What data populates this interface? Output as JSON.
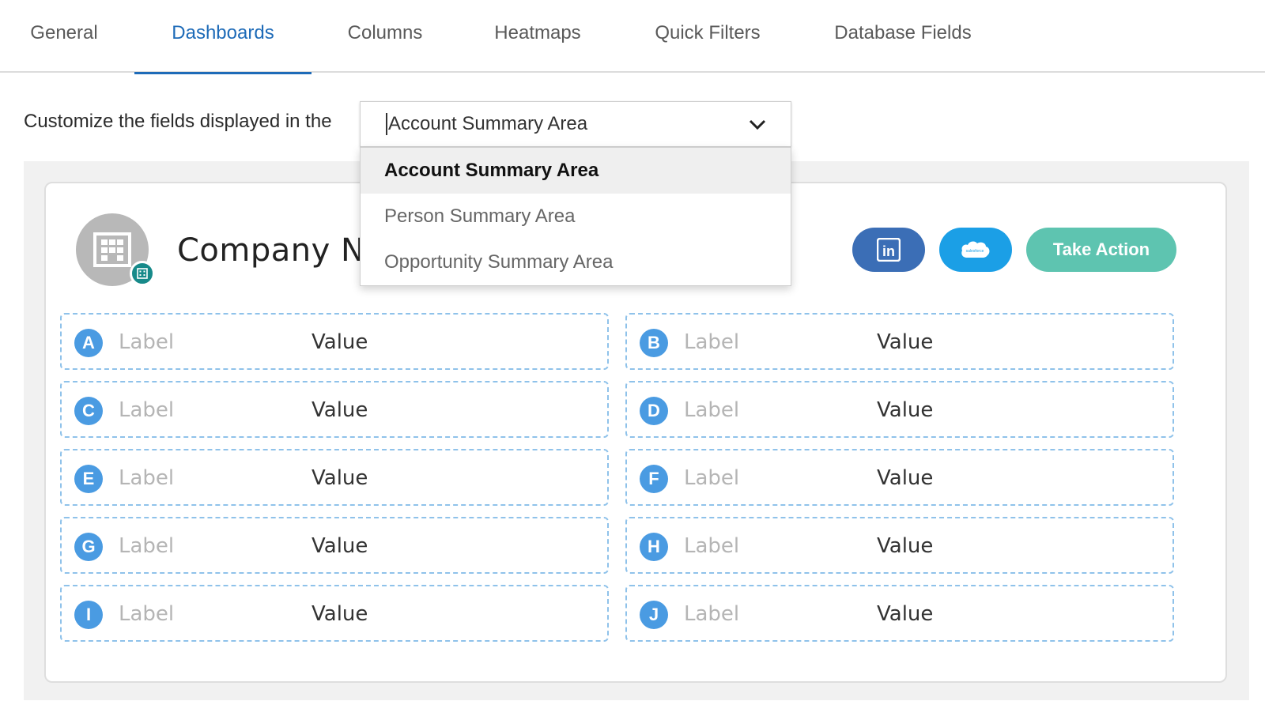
{
  "tabs": [
    {
      "label": "General"
    },
    {
      "label": "Dashboards"
    },
    {
      "label": "Columns"
    },
    {
      "label": "Heatmaps"
    },
    {
      "label": "Quick Filters"
    },
    {
      "label": "Database Fields"
    }
  ],
  "active_tab": "Dashboards",
  "prompt": "Customize the fields displayed in the",
  "select": {
    "current": "Account Summary Area",
    "options": [
      "Account Summary Area",
      "Person Summary Area",
      "Opportunity Summary Area"
    ]
  },
  "card": {
    "company_name": "Company Na",
    "take_action_label": "Take Action",
    "linkedin_text": "in",
    "salesforce_text": "salesforce"
  },
  "fields": [
    {
      "letter": "A",
      "label": "Label",
      "value": "Value"
    },
    {
      "letter": "B",
      "label": "Label",
      "value": "Value"
    },
    {
      "letter": "C",
      "label": "Label",
      "value": "Value"
    },
    {
      "letter": "D",
      "label": "Label",
      "value": "Value"
    },
    {
      "letter": "E",
      "label": "Label",
      "value": "Value"
    },
    {
      "letter": "F",
      "label": "Label",
      "value": "Value"
    },
    {
      "letter": "G",
      "label": "Label",
      "value": "Value"
    },
    {
      "letter": "H",
      "label": "Label",
      "value": "Value"
    },
    {
      "letter": "I",
      "label": "Label",
      "value": "Value"
    },
    {
      "letter": "J",
      "label": "Label",
      "value": "Value"
    }
  ],
  "colors": {
    "accent": "#1e6bb8",
    "linkedin": "#3b6eb6",
    "salesforce": "#1b9fe6",
    "take_action": "#5ec4b0",
    "field_letter": "#4a9be2"
  }
}
